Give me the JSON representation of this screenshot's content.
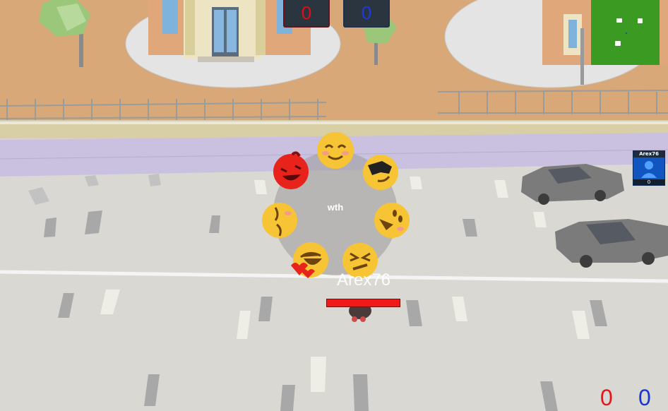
{
  "scoreboard": {
    "red_score": "0",
    "blue_score": "0"
  },
  "player": {
    "name": "Arex76",
    "health_fraction": 1.0
  },
  "player_card": {
    "name": "Arex76",
    "score": "0"
  },
  "emote_wheel": {
    "center_label": "wth",
    "emotes": [
      "grinning-squint-icon",
      "smiling-blush-icon",
      "sunglasses-icon",
      "laughing-icon",
      "heart-eyes-icon",
      "winking-icon",
      "kissing-icon",
      "persevering-icon"
    ]
  },
  "bottom_score": {
    "red": "0",
    "blue": "0"
  },
  "colors": {
    "team_red": "#e10d16",
    "team_blue": "#1c3bd8",
    "minimap": "#3a9a22",
    "health": "#f01a1a"
  }
}
